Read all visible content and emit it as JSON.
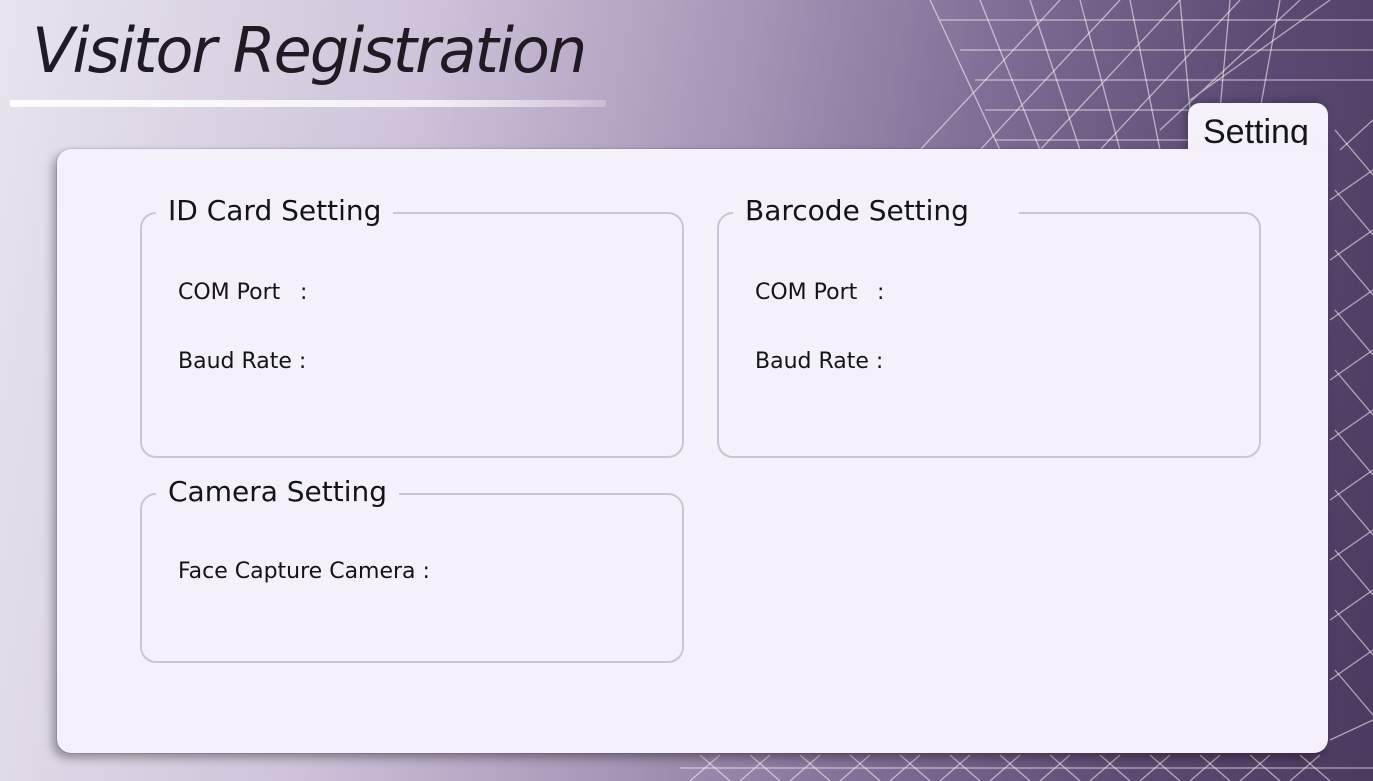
{
  "app": {
    "title": "Visitor Registration"
  },
  "tab": {
    "label": "Setting"
  },
  "groups": {
    "id_card": {
      "title": "ID Card Setting",
      "com_port_label": "COM Port",
      "com_port_sep": ":",
      "baud_rate_label": "Baud Rate :"
    },
    "barcode": {
      "title": "Barcode Setting",
      "com_port_label": "COM Port",
      "com_port_sep": ":",
      "baud_rate_label": "Baud Rate :"
    },
    "camera": {
      "title": "Camera Setting",
      "face_camera_label": "Face Capture Camera :"
    }
  },
  "colors": {
    "panel": "#f5f1fb",
    "group_border": "#cdc3d8",
    "background_dark": "#4a3a5f",
    "background_light": "#e9e4ee"
  }
}
